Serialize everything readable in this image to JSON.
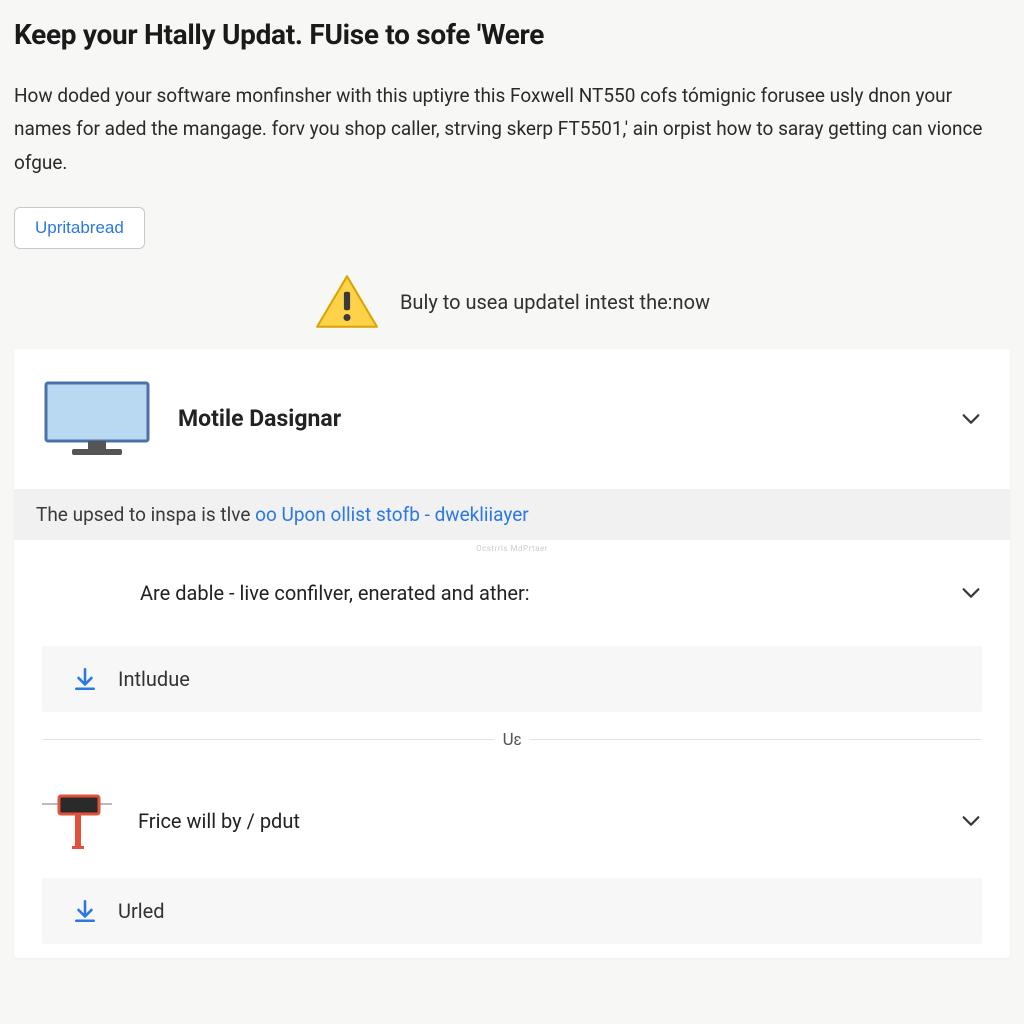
{
  "header": {
    "title": "Keep your Htally Updat. FUise to sofe 'Were"
  },
  "intro": {
    "paragraph": "How doded your software monfinsher with this uptiyre this Foxwell NT550 cofs tómignic forusee usly dnon your names for aded the mangage. forv you shop caller, strving skerp FT5501,' ain orpist how to saray getting can vionce ofgue."
  },
  "cta": {
    "uprita_label": "Upritabread"
  },
  "banner": {
    "text": "Buly to usea updatel intest the:now"
  },
  "card": {
    "row1": {
      "title": "Motile Dasignar"
    },
    "subheader": {
      "prefix": "The upsed to inspa is tlve ",
      "link": "oo Upon ollist stofb - dwekliiayer"
    },
    "row2": {
      "mini": "Ocstrrls MdPrtaer",
      "title": "Are dable - live confilver, enerated and ather:"
    },
    "download1": {
      "label": "Intludue"
    },
    "divider": {
      "label": "Uɛ"
    },
    "row3": {
      "title": "Frice will by / pdut"
    },
    "download2": {
      "label": "Urled"
    }
  },
  "icons": {
    "warning": "warning-triangle-icon",
    "monitor": "monitor-icon",
    "chevron": "chevron-down-icon",
    "device": "obd-device-icon",
    "download": "download-icon",
    "signpost": "signpost-icon"
  }
}
